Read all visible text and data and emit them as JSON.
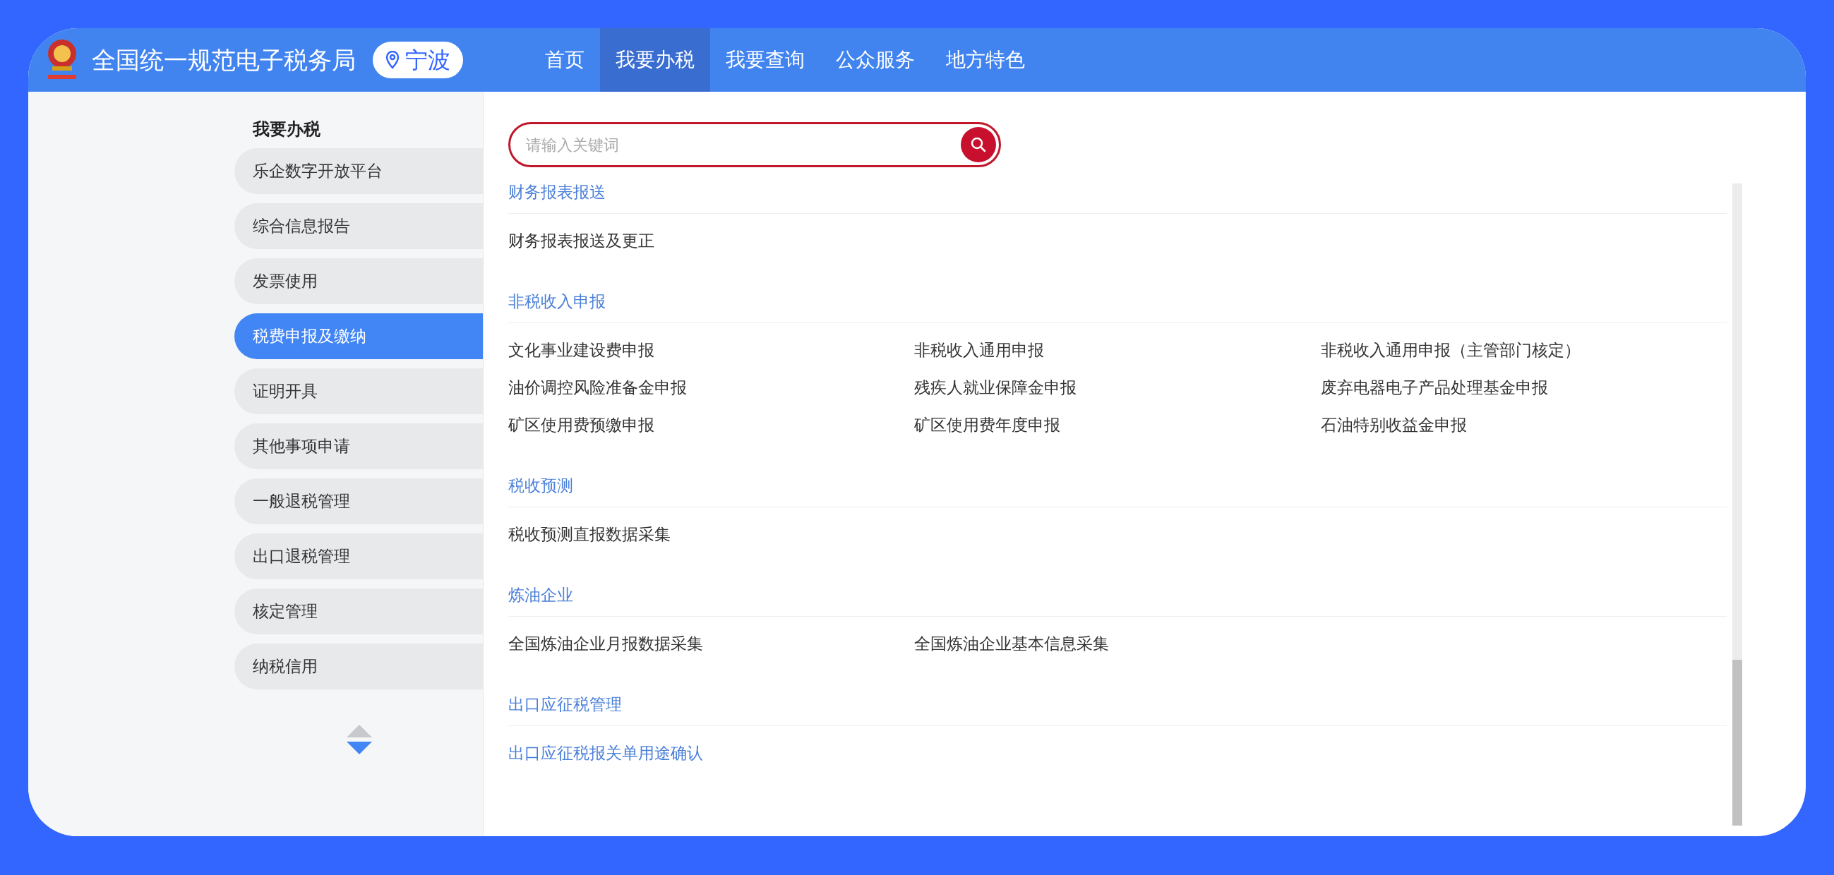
{
  "header": {
    "title": "全国统一规范电子税务局",
    "location": "宁波",
    "nav": [
      {
        "label": "首页",
        "selected": false
      },
      {
        "label": "我要办税",
        "selected": true
      },
      {
        "label": "我要查询",
        "selected": false
      },
      {
        "label": "公众服务",
        "selected": false
      },
      {
        "label": "地方特色",
        "selected": false
      }
    ]
  },
  "sidebar": {
    "heading": "我要办税",
    "items": [
      {
        "label": "乐企数字开放平台",
        "selected": false
      },
      {
        "label": "综合信息报告",
        "selected": false
      },
      {
        "label": "发票使用",
        "selected": false
      },
      {
        "label": "税费申报及缴纳",
        "selected": true
      },
      {
        "label": "证明开具",
        "selected": false
      },
      {
        "label": "其他事项申请",
        "selected": false
      },
      {
        "label": "一般退税管理",
        "selected": false
      },
      {
        "label": "出口退税管理",
        "selected": false
      },
      {
        "label": "核定管理",
        "selected": false
      },
      {
        "label": "纳税信用",
        "selected": false
      }
    ]
  },
  "search": {
    "placeholder": "请输入关键词"
  },
  "sections": [
    {
      "title": "财务报表报送",
      "items": [
        {
          "label": "财务报表报送及更正",
          "highlighted": false
        }
      ]
    },
    {
      "title": "非税收入申报",
      "items": [
        {
          "label": "文化事业建设费申报",
          "highlighted": false
        },
        {
          "label": "非税收入通用申报",
          "highlighted": false
        },
        {
          "label": "非税收入通用申报（主管部门核定）",
          "highlighted": false
        },
        {
          "label": "油价调控风险准备金申报",
          "highlighted": false
        },
        {
          "label": "残疾人就业保障金申报",
          "highlighted": false
        },
        {
          "label": "废弃电器电子产品处理基金申报",
          "highlighted": false
        },
        {
          "label": "矿区使用费预缴申报",
          "highlighted": false
        },
        {
          "label": "矿区使用费年度申报",
          "highlighted": false
        },
        {
          "label": "石油特别收益金申报",
          "highlighted": false
        }
      ]
    },
    {
      "title": "税收预测",
      "items": [
        {
          "label": "税收预测直报数据采集",
          "highlighted": false
        }
      ]
    },
    {
      "title": "炼油企业",
      "items": [
        {
          "label": "全国炼油企业月报数据采集",
          "highlighted": false
        },
        {
          "label": "全国炼油企业基本信息采集",
          "highlighted": false
        }
      ]
    },
    {
      "title": "出口应征税管理",
      "items": [
        {
          "label": "出口应征税报关单用途确认",
          "highlighted": true
        }
      ]
    }
  ]
}
